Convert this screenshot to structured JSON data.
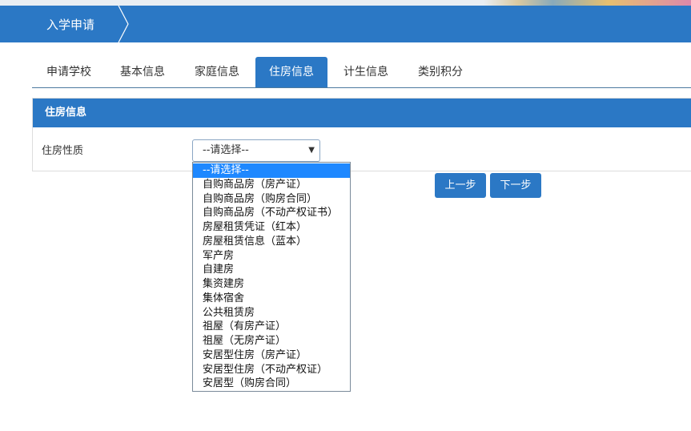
{
  "header": {
    "breadcrumb": "入学申请"
  },
  "tabs": [
    {
      "label": "申请学校"
    },
    {
      "label": "基本信息"
    },
    {
      "label": "家庭信息"
    },
    {
      "label": "住房信息",
      "active": true
    },
    {
      "label": "计生信息"
    },
    {
      "label": "类别积分"
    }
  ],
  "panel": {
    "title": "住房信息",
    "field_label": "住房性质",
    "select_value": "--请选择--"
  },
  "options": [
    "--请选择--",
    "自购商品房（房产证）",
    "自购商品房（购房合同）",
    "自购商品房（不动产权证书）",
    "房屋租赁凭证（红本）",
    "房屋租赁信息（蓝本）",
    "军产房",
    "自建房",
    "集资建房",
    "集体宿舍",
    "公共租赁房",
    "祖屋（有房产证）",
    "祖屋（无房产证）",
    "安居型住房（房产证）",
    "安居型住房（不动产权证）",
    "安居型（购房合同）"
  ],
  "buttons": {
    "prev": "上一步",
    "next": "下一步"
  },
  "colors": {
    "primary": "#2b78c5",
    "highlight": "#1e88ff"
  }
}
